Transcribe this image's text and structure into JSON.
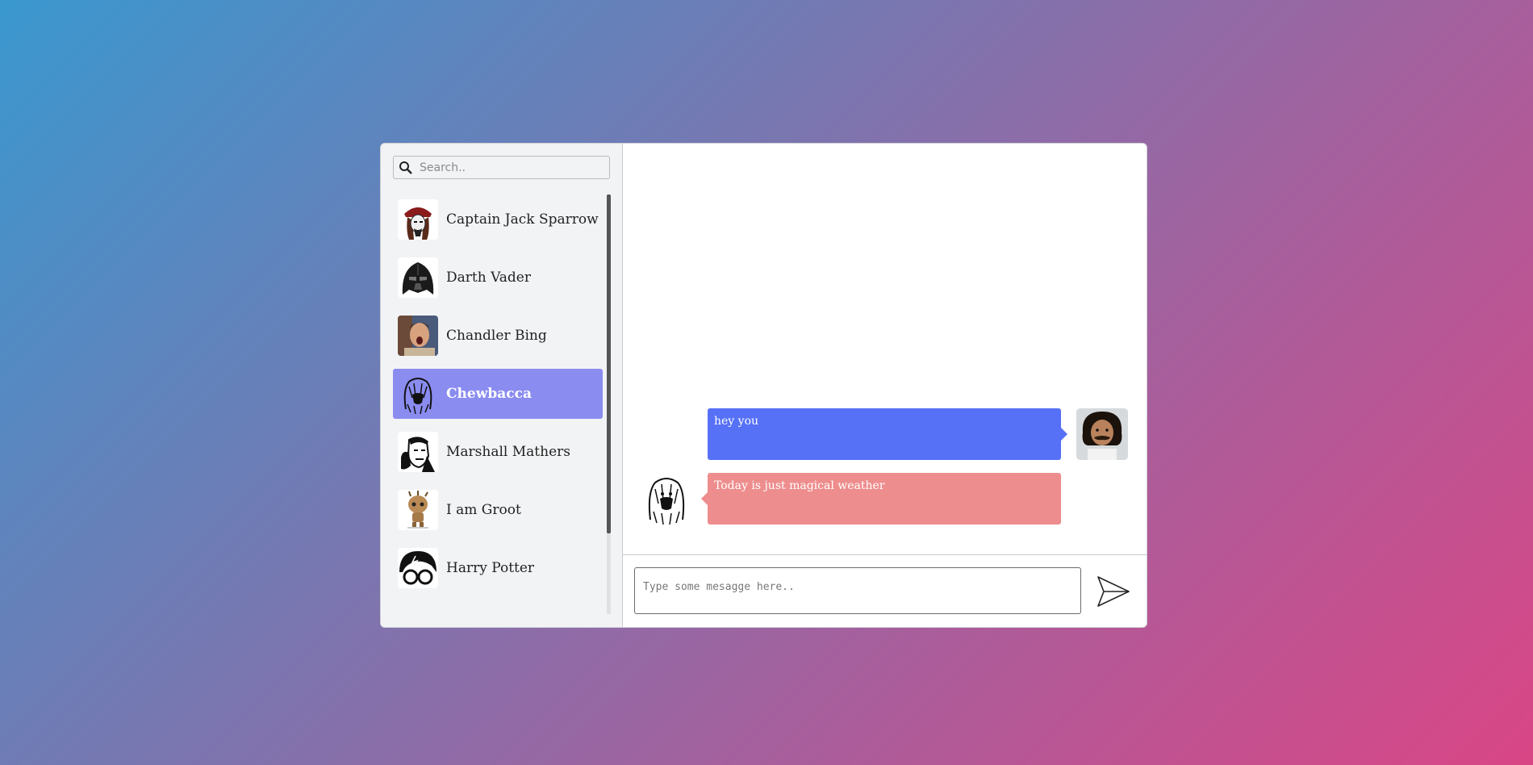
{
  "search": {
    "placeholder": "Search.."
  },
  "contacts": [
    {
      "name": "Captain Jack Sparrow",
      "icon": "pirate-avatar"
    },
    {
      "name": "Darth Vader",
      "icon": "vader-helmet-avatar"
    },
    {
      "name": "Chandler Bing",
      "icon": "chandler-photo-avatar"
    },
    {
      "name": "Chewbacca",
      "icon": "chewbacca-avatar",
      "active": true
    },
    {
      "name": "Marshall Mathers",
      "icon": "eminem-avatar"
    },
    {
      "name": "I am Groot",
      "icon": "groot-avatar"
    },
    {
      "name": "Harry Potter",
      "icon": "harry-potter-glasses-avatar"
    }
  ],
  "messages": [
    {
      "direction": "out",
      "text": "hey you",
      "color": "#5670f6"
    },
    {
      "direction": "in",
      "text": "Today is just magical weather",
      "color": "#ee8d8d"
    }
  ],
  "composer": {
    "placeholder": "Type some mesagge here.."
  },
  "colors": {
    "active_contact": "#8a8cf0",
    "outgoing": "#5670f6",
    "incoming": "#ee8d8d"
  }
}
